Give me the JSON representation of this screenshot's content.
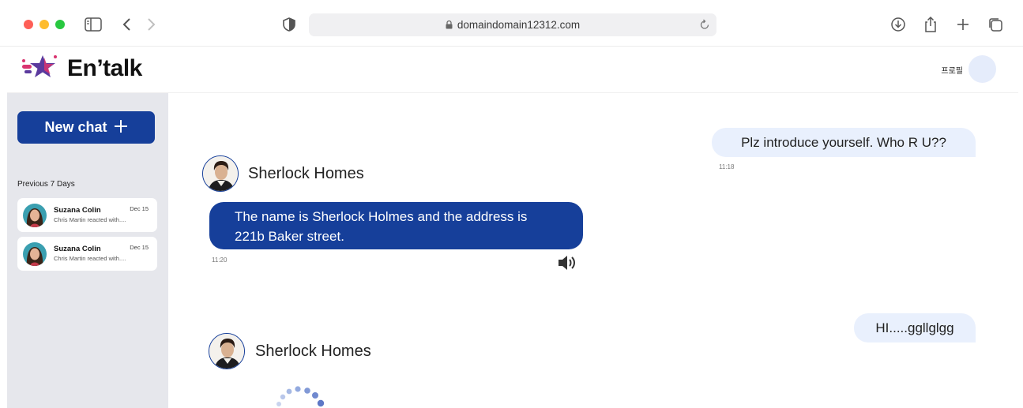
{
  "browser": {
    "url": "domaindomain12312.com",
    "icons": [
      "sidebar-toggle-icon",
      "back-icon",
      "forward-icon",
      "privacy-shield-icon",
      "lock-icon",
      "reload-icon",
      "download-icon",
      "share-icon",
      "new-tab-icon",
      "tab-overview-icon"
    ]
  },
  "app": {
    "brand": "En’talk",
    "profile_label": "프로필"
  },
  "sidebar": {
    "new_chat_label": "New chat",
    "section_label": "Previous 7 Days",
    "conversations": [
      {
        "name": "Suzana Colin",
        "preview": "Chris Martin reacted with....",
        "date": "Dec 15"
      },
      {
        "name": "Suzana Colin",
        "preview": "Chris Martin reacted with....",
        "date": "Dec 15"
      }
    ]
  },
  "chat": {
    "messages": [
      {
        "role": "user",
        "text": "Plz introduce yourself. Who R U??",
        "time": "11:18"
      },
      {
        "role": "bot",
        "sender": "Sherlock Homes",
        "text_line1": "The name is Sherlock Holmes and the address is",
        "text_line2": "221b Baker street.",
        "time": "11:20"
      },
      {
        "role": "user",
        "text": "HI.....ggllglgg"
      },
      {
        "role": "bot",
        "sender": "Sherlock Homes",
        "status": "loading"
      }
    ]
  },
  "colors": {
    "brand_blue": "#163f9a",
    "user_bubble": "#e9f0fd",
    "sidebar_bg": "#e6e7ec",
    "logo_pink": "#d9346f",
    "logo_purple": "#5b3a9e"
  }
}
